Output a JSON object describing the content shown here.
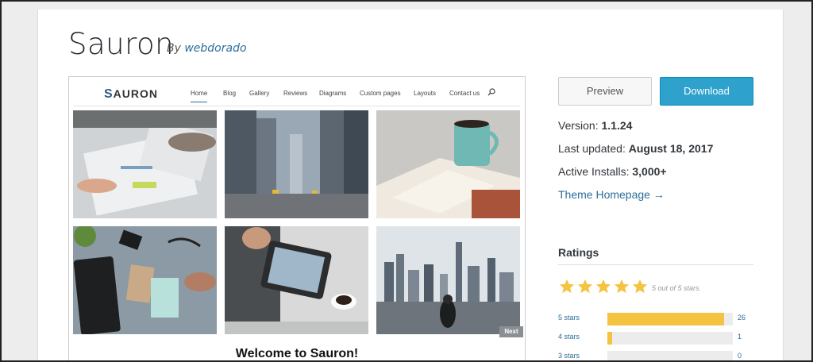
{
  "theme": {
    "title": "Sauron",
    "by_prefix": "By",
    "author": "webdorado"
  },
  "screenshot": {
    "logo_text": "AURON",
    "logo_mark": "S",
    "nav": [
      "Home",
      "Blog",
      "Gallery",
      "Reviews",
      "Diagrams",
      "Custom pages",
      "Layouts",
      "Contact us"
    ],
    "next_label": "Next",
    "welcome": "Welcome to Sauron!"
  },
  "actions": {
    "preview_label": "Preview",
    "download_label": "Download"
  },
  "meta": {
    "version_label": "Version:",
    "version_value": "1.1.24",
    "updated_label": "Last updated:",
    "updated_value": "August 18, 2017",
    "installs_label": "Active Installs:",
    "installs_value": "3,000+",
    "homepage_label": "Theme Homepage →"
  },
  "ratings": {
    "title": "Ratings",
    "stars_text": "5 out of 5 stars.",
    "star_rating": 5,
    "rows": [
      {
        "label": "5 stars",
        "count": "26",
        "fraction": 0.93
      },
      {
        "label": "4 stars",
        "count": "1",
        "fraction": 0.04
      },
      {
        "label": "3 stars",
        "count": "0",
        "fraction": 0.0
      }
    ]
  },
  "colors": {
    "link": "#2b6e99",
    "download_bg": "#2ea2cc",
    "star": "#f5c342"
  }
}
